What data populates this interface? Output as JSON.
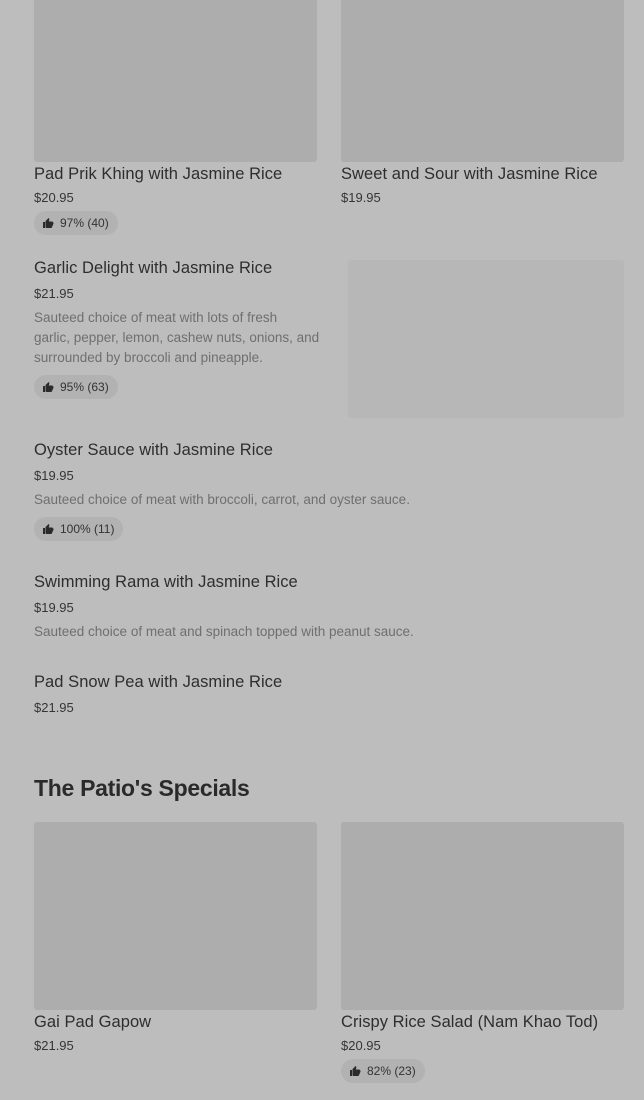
{
  "colors": {
    "background": "#bdbdbd",
    "image_placeholder": "#adadad",
    "badge_bg": "#b2b2b2"
  },
  "top_cards": [
    {
      "name": "Pad Prik Khing with Jasmine Rice",
      "price": "$20.95",
      "rating": "97% (40)",
      "icon": "thumbs-up-icon"
    },
    {
      "name": "Sweet and Sour with Jasmine Rice",
      "price": "$19.95"
    }
  ],
  "list_items": [
    {
      "name": "Garlic Delight with Jasmine Rice",
      "price": "$21.95",
      "description_lines": [
        "Sauteed choice of meat with lots of fresh",
        "garlic, pepper, lemon, cashew nuts, onions, and",
        "surrounded by broccoli and pineapple."
      ],
      "rating": "95% (63)"
    },
    {
      "name": "Oyster Sauce with Jasmine Rice",
      "price": "$19.95",
      "description": "Sauteed choice of meat with broccoli, carrot, and oyster sauce.",
      "rating": "100% (11)"
    },
    {
      "name": "Swimming Rama with Jasmine Rice",
      "price": "$19.95",
      "description": "Sauteed choice of meat and spinach topped with peanut sauce."
    },
    {
      "name": "Pad Snow Pea with Jasmine Rice",
      "price": "$21.95"
    }
  ],
  "section": {
    "title": "The Patio's Specials"
  },
  "special_cards": [
    {
      "name": "Gai Pad Gapow",
      "price": "$21.95"
    },
    {
      "name": "Crispy Rice Salad (Nam Khao Tod)",
      "price": "$20.95",
      "rating": "82% (23)"
    }
  ]
}
